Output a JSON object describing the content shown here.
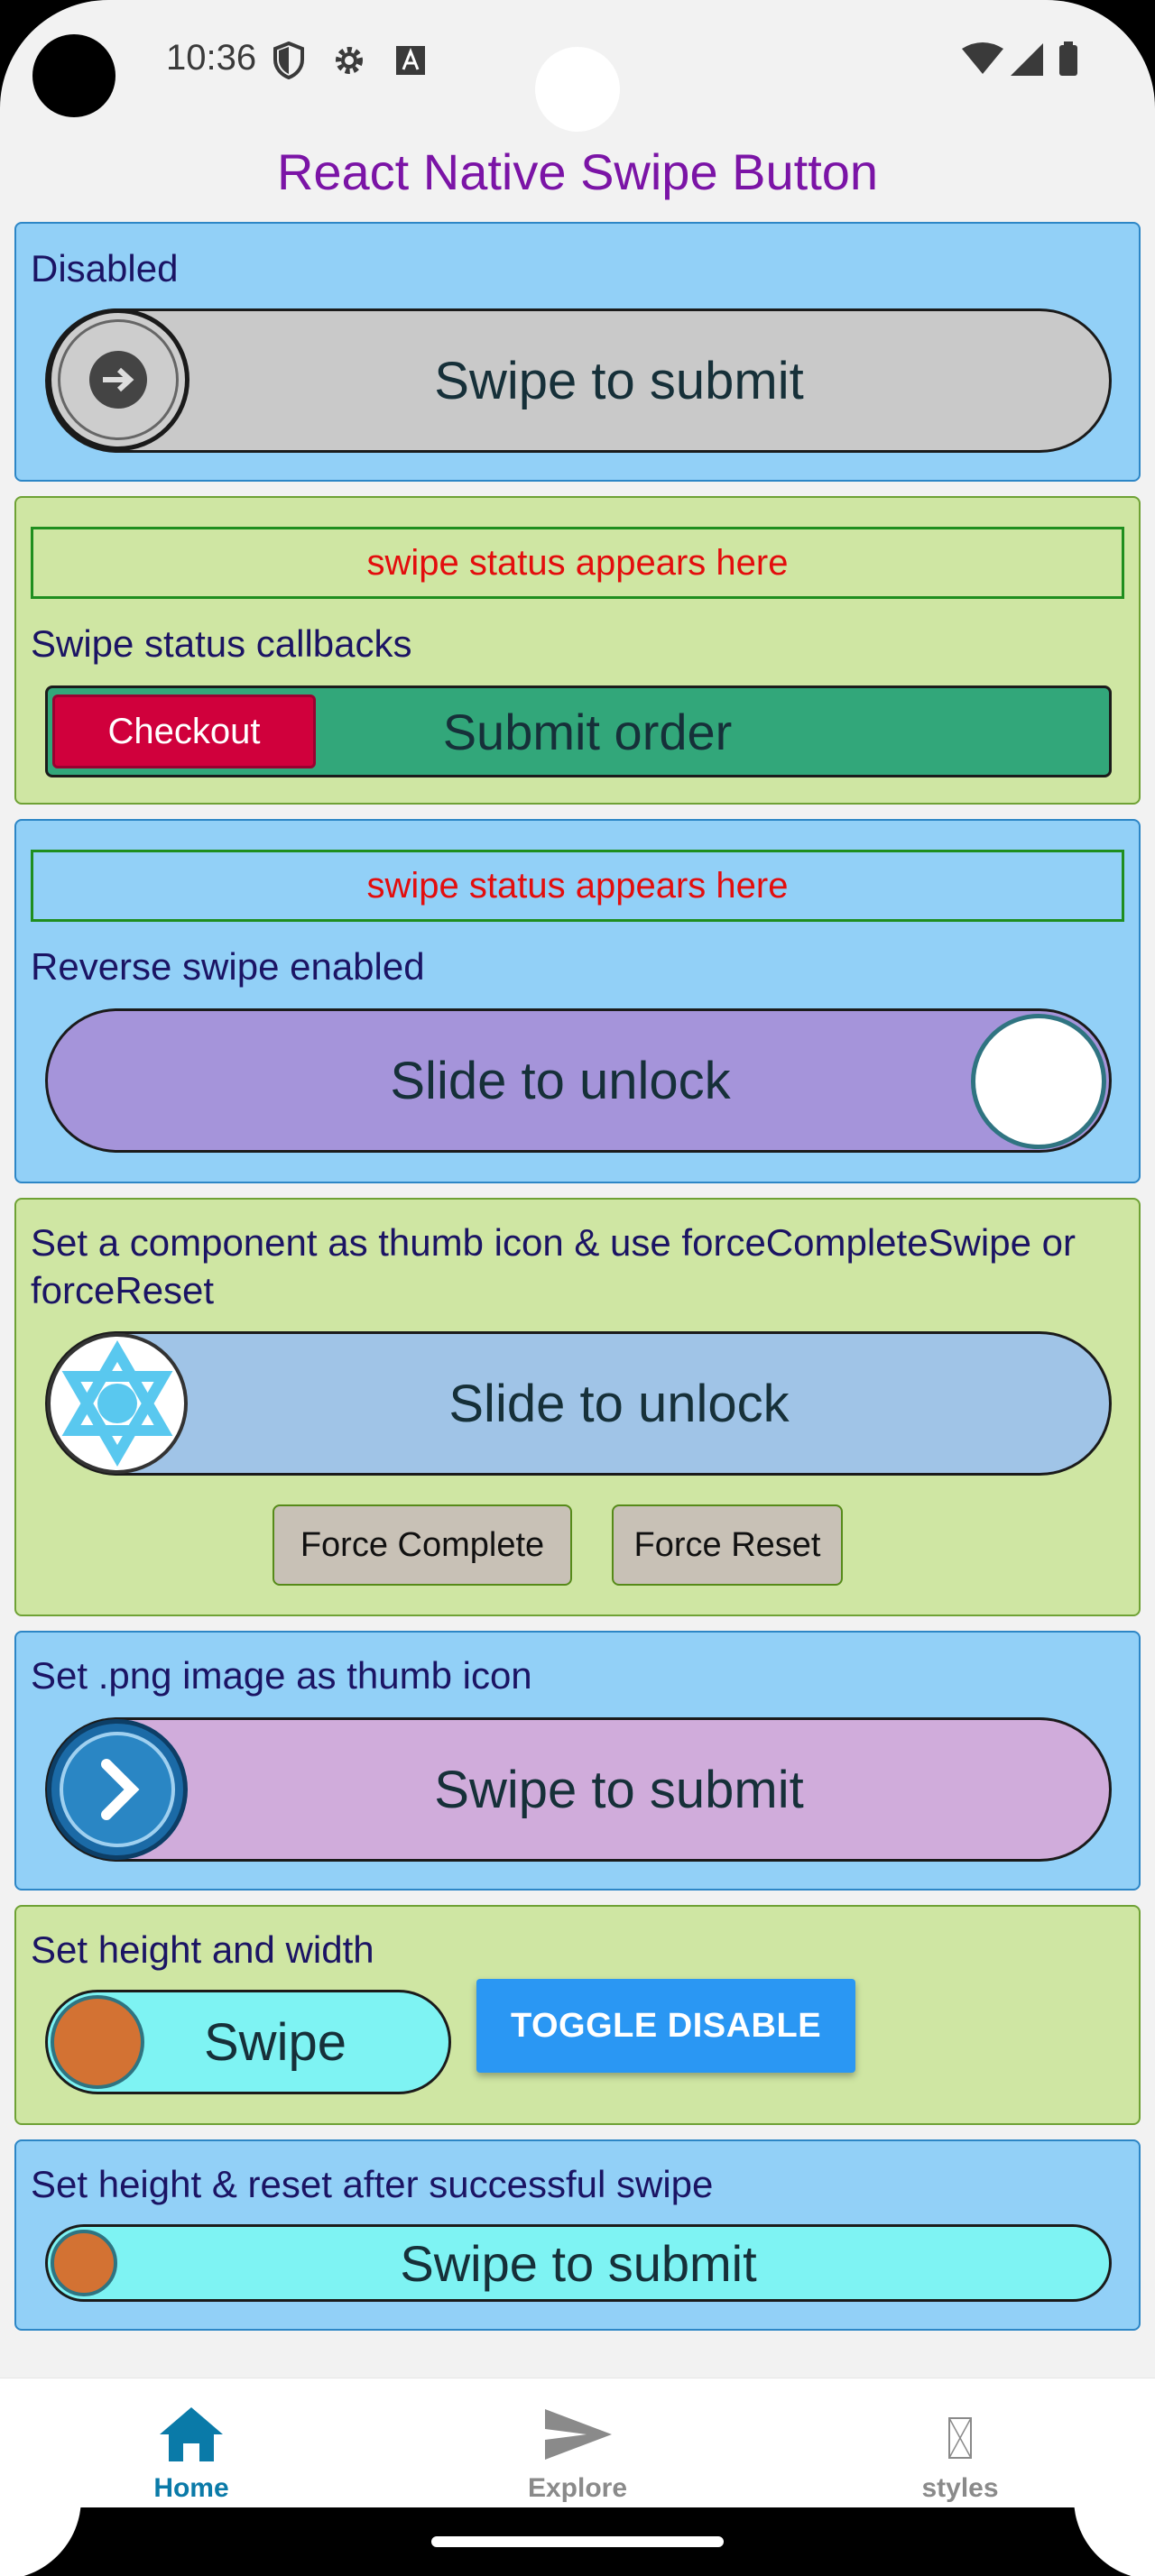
{
  "status_bar": {
    "time": "10:36"
  },
  "app": {
    "title": "React Native Swipe Button"
  },
  "sections": {
    "disabled": {
      "label": "Disabled",
      "rail_title": "Swipe to submit"
    },
    "callbacks": {
      "status": "swipe status appears here",
      "label": "Swipe status callbacks",
      "thumb_label": "Checkout",
      "rail_title": "Submit order"
    },
    "reverse": {
      "status": "swipe status appears here",
      "label": "Reverse swipe enabled",
      "rail_title": "Slide to unlock"
    },
    "component_thumb": {
      "label": "Set a component as thumb icon & use forceCompleteSwipe or forceReset",
      "rail_title": "Slide to unlock",
      "force_complete": "Force Complete",
      "force_reset": "Force Reset"
    },
    "png_thumb": {
      "label": "Set .png image as thumb icon",
      "rail_title": "Swipe to submit"
    },
    "size": {
      "label": "Set height and width",
      "rail_title": "Swipe",
      "toggle_button": "TOGGLE DISABLE"
    },
    "reset": {
      "label": "Set height & reset after successful swipe",
      "rail_title": "Swipe to submit"
    }
  },
  "bottom_nav": {
    "items": [
      {
        "label": "Home",
        "icon": "home-icon",
        "active": true
      },
      {
        "label": "Explore",
        "icon": "send-icon",
        "active": false
      },
      {
        "label": "styles",
        "icon": "missing-glyph-icon",
        "active": false
      }
    ]
  },
  "colors": {
    "title": "#7b14a6",
    "card_blue": "#92d0f7",
    "card_green": "#cfe6a3",
    "status_text": "#e30d0d",
    "nav_active": "#0a7aa8",
    "nav_inactive": "#8a8a8a"
  }
}
